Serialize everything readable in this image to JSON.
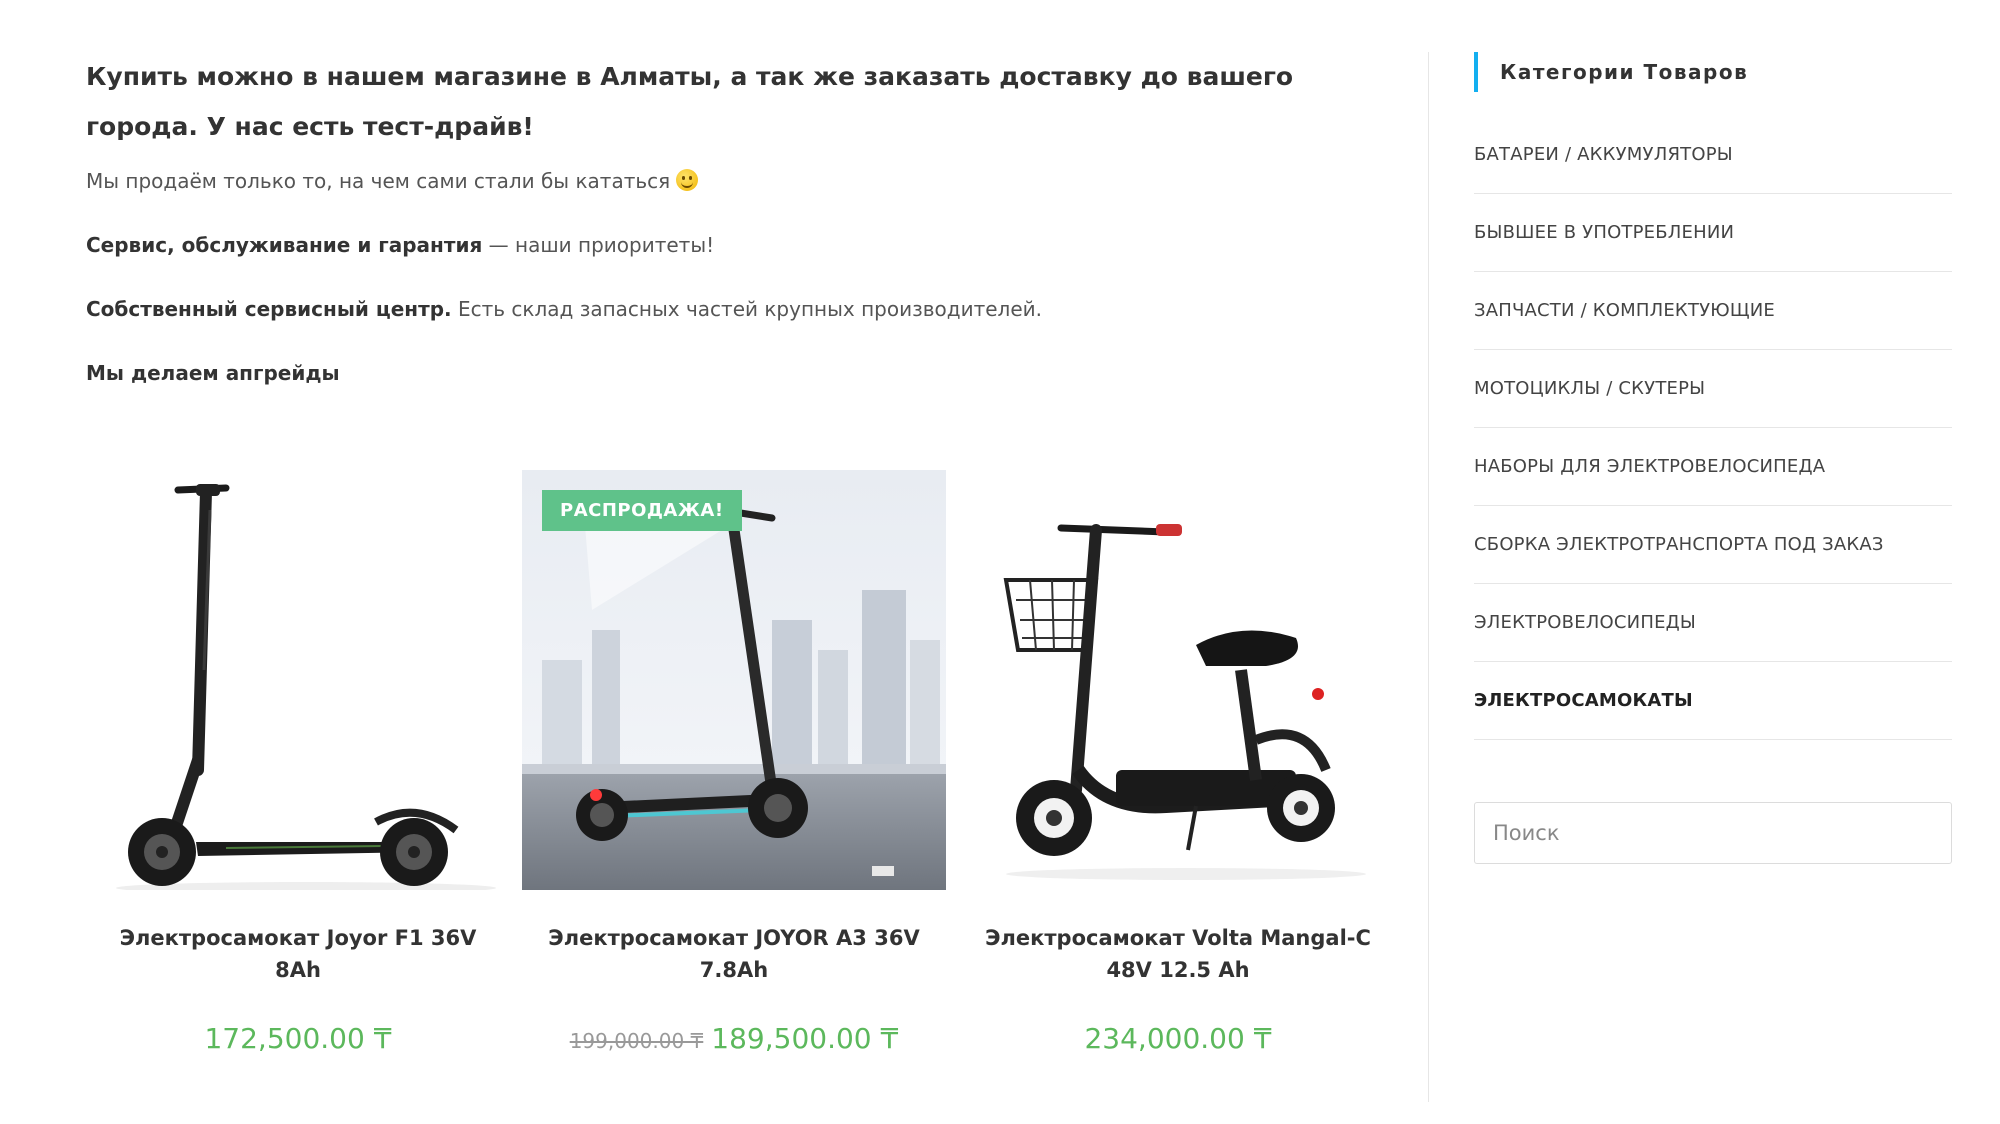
{
  "intro": {
    "headline": "Купить  можно в нашем магазине в Алматы, а так же заказать доставку до вашего города. У нас есть тест-драйв!",
    "line1": "Мы продаём только то, на чем сами стали бы кататься",
    "line2_bold": "Сервис, обслуживание и гарантия",
    "line2_rest": " — наши приоритеты!",
    "line3_bold": "Собственный сервисный центр.",
    "line3_rest": " Есть склад запасных частей крупных производителей.",
    "line4_bold": "Мы делаем апгрейды"
  },
  "products": [
    {
      "title": "Электросамокат Joyor F1 36V 8Ah",
      "price": "172,500.00 ₸"
    },
    {
      "title": "Электросамокат JOYOR A3 36V 7.8Ah",
      "badge": "РАСПРОДАЖА!",
      "old_price": "199,000.00 ₸",
      "price": "189,500.00 ₸"
    },
    {
      "title": "Электросамокат Volta Mangal-C 48V 12.5 Ah",
      "price": "234,000.00 ₸"
    }
  ],
  "sidebar": {
    "title": "Категории Товаров",
    "categories": [
      "БАТАРЕИ / АККУМУЛЯТОРЫ",
      "БЫВШЕЕ В УПОТРЕБЛЕНИИ",
      "ЗАПЧАСТИ / КОМПЛЕКТУЮЩИЕ",
      "МОТОЦИКЛЫ / СКУТЕРЫ",
      "НАБОРЫ ДЛЯ ЭЛЕКТРОВЕЛОСИПЕДА",
      "СБОРКА ЭЛЕКТРОТРАНСПОРТА ПОД ЗАКАЗ",
      "ЭЛЕКТРОВЕЛОСИПЕДЫ",
      "ЭЛЕКТРОСАМОКАТЫ"
    ],
    "search_placeholder": "Поиск"
  },
  "colors": {
    "price_green": "#5cb85c",
    "badge_green": "#5fc28a",
    "accent_blue": "#13aff0"
  }
}
